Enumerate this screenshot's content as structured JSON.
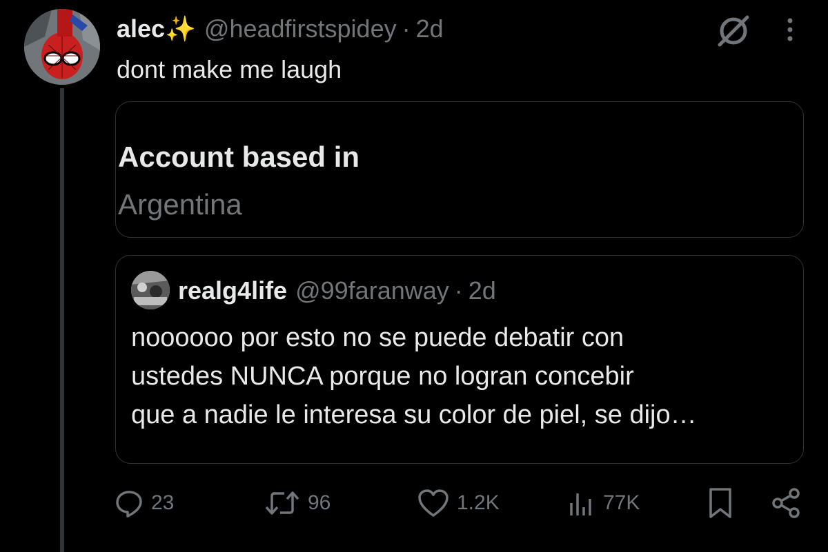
{
  "tweet": {
    "display_name": "alec",
    "name_emoji": "✨",
    "handle": "@headfirstspidey",
    "separator": "·",
    "time": "2d",
    "text": "dont make me laugh",
    "avatar_icon": "spider-man-avatar",
    "grok_icon": "grok-icon",
    "more_icon": "more-vertical-icon"
  },
  "about_card": {
    "title": "Account based in",
    "value": "Argentina"
  },
  "quoted_tweet": {
    "display_name": "realg4life",
    "handle": "@99faranway",
    "separator": "·",
    "time": "2d",
    "text_lines": [
      "noooooo por esto no se puede debatir con",
      "ustedes NUNCA porque no logran concebir",
      "que a nadie le interesa su color de piel, se dijo…"
    ]
  },
  "actions": {
    "reply": {
      "icon": "reply-icon",
      "count": "23"
    },
    "retweet": {
      "icon": "retweet-icon",
      "count": "96"
    },
    "like": {
      "icon": "heart-icon",
      "count": "1.2K"
    },
    "views": {
      "icon": "views-icon",
      "count": "77K"
    },
    "bookmark": {
      "icon": "bookmark-icon"
    },
    "share": {
      "icon": "share-icon"
    }
  },
  "colors": {
    "background": "#000000",
    "primary_text": "#e7e9ea",
    "secondary_text": "#71767b",
    "border": "#2f3336",
    "sparkle": "#f7c31a"
  }
}
